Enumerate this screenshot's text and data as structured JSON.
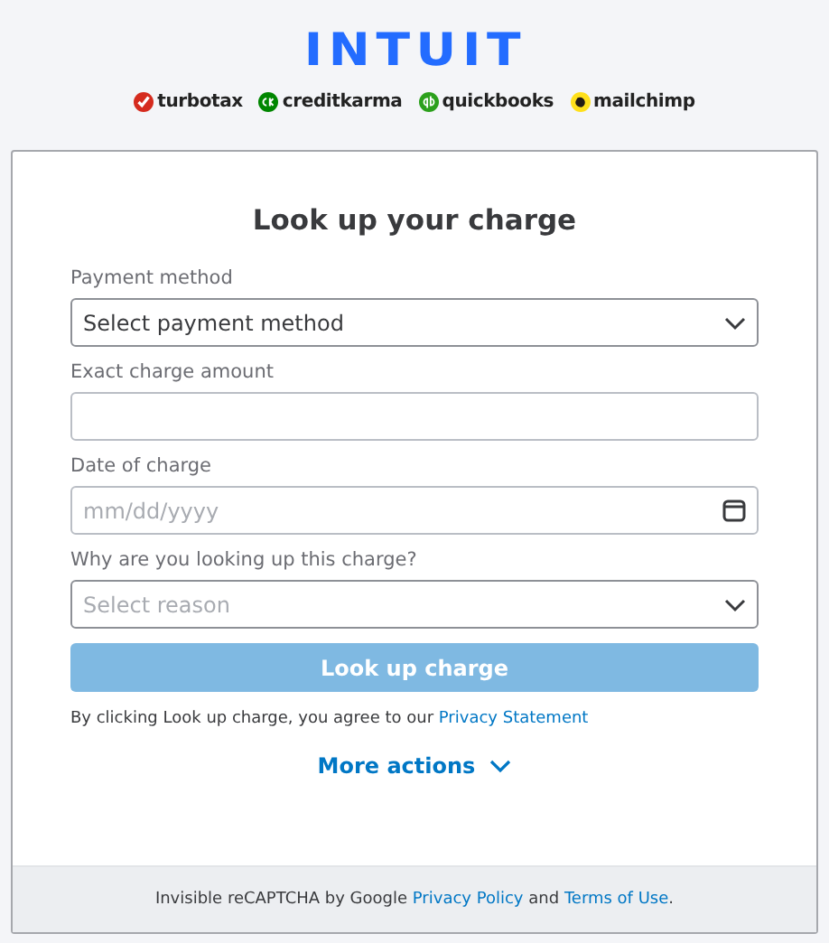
{
  "header": {
    "logo": "INTUIT",
    "brands": [
      {
        "name": "turbotax",
        "color": "#d52b1e"
      },
      {
        "name": "creditkarma",
        "color": "#008600"
      },
      {
        "name": "quickbooks",
        "color": "#2ca01c"
      },
      {
        "name": "mailchimp",
        "color": "#ffe01b"
      }
    ]
  },
  "form": {
    "title": "Look up your charge",
    "fields": [
      {
        "kind": "select",
        "label": "Payment method",
        "value": "Select payment method"
      },
      {
        "kind": "text",
        "label": "Exact charge amount"
      },
      {
        "kind": "date",
        "label": "Date of charge",
        "placeholder": "mm/dd/yyyy"
      },
      {
        "kind": "select",
        "label": "Why are you looking up this charge?",
        "placeholder": "Select reason"
      }
    ],
    "button": {
      "label": "Look up charge",
      "disabled": true
    },
    "consent": [
      {
        "kind": "text",
        "text": "By clicking Look up charge, you agree to our"
      },
      {
        "kind": "link",
        "text": "Privacy Statement"
      }
    ],
    "more_actions": {
      "label": "More actions",
      "expanded": false
    }
  },
  "footer": [
    {
      "kind": "text",
      "text": "Invisible reCAPTCHA by Google"
    },
    {
      "kind": "link",
      "text": "Privacy Policy"
    },
    {
      "kind": "text",
      "text": "and"
    },
    {
      "kind": "link",
      "text": "Terms of Use"
    },
    {
      "kind": "text",
      "text": "."
    }
  ]
}
